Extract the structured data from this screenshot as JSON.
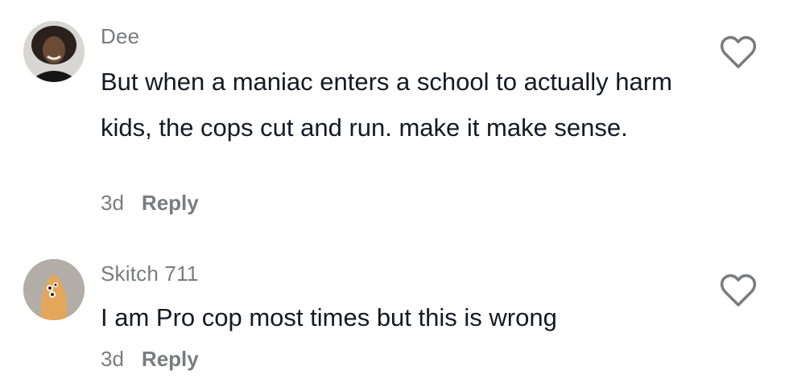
{
  "comments": [
    {
      "username": "Dee",
      "text": "But when a maniac enters a school to actually harm kids, the cops cut and run. make it make sense.",
      "time": "3d",
      "reply_label": "Reply",
      "avatar_icon": "profile-photo-avatar",
      "like_icon": "heart-outline-icon"
    },
    {
      "username": "Skitch 711",
      "text": "I am Pro cop most times but this is wrong",
      "time": "3d",
      "reply_label": "Reply",
      "avatar_icon": "cartoon-character-avatar",
      "like_icon": "heart-outline-icon"
    }
  ],
  "colors": {
    "text_primary": "#161823",
    "text_secondary": "#7a7b80",
    "icon_stroke": "#7a7b80"
  }
}
